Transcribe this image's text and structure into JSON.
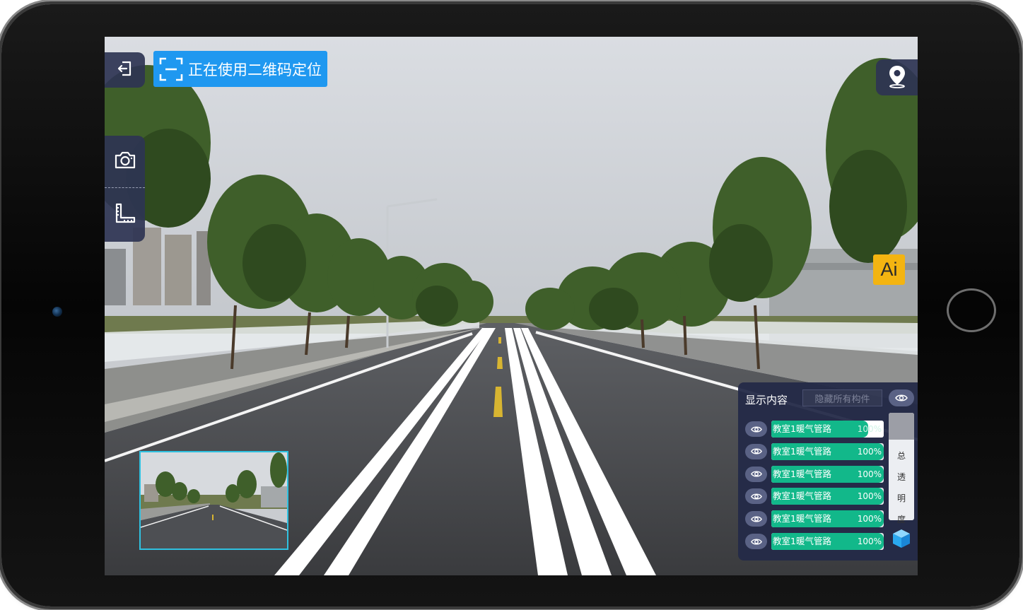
{
  "header": {
    "back_icon": "exit-icon",
    "qr_status_icon": "scan-frame-icon",
    "qr_status_label": "正在使用二维码定位"
  },
  "toolbar": {
    "camera_icon": "camera-icon",
    "measure_icon": "ruler-angle-icon"
  },
  "location_button": {
    "icon": "map-pin-icon"
  },
  "ai_button": {
    "label": "Ai"
  },
  "display_panel": {
    "title": "显示内容",
    "hide_all_label": "隐藏所有构件",
    "eye_all_icon": "eye-icon",
    "items": [
      {
        "name": "教室1暖气管路",
        "value": "100%",
        "level": 0.86
      },
      {
        "name": "教室1暖气管路",
        "value": "100%",
        "level": 1.0
      },
      {
        "name": "教室1暖气管路",
        "value": "100%",
        "level": 1.0
      },
      {
        "name": "教室1暖气管路",
        "value": "100%",
        "level": 1.0
      },
      {
        "name": "教室1暖气管路",
        "value": "100%",
        "level": 1.0
      },
      {
        "name": "教室1暖气管路",
        "value": "100%",
        "level": 1.0
      }
    ],
    "opacity_label": "总透明度",
    "opacity_chars": [
      "总",
      "透",
      "明",
      "度"
    ],
    "cube_icon": "cube-icon"
  },
  "colors": {
    "accent_blue": "#1f98f0",
    "panel_bg": "#242a48",
    "progress_green": "#12b88a",
    "ai_yellow": "#f3b411",
    "minimap_border": "#2fc1e0"
  }
}
